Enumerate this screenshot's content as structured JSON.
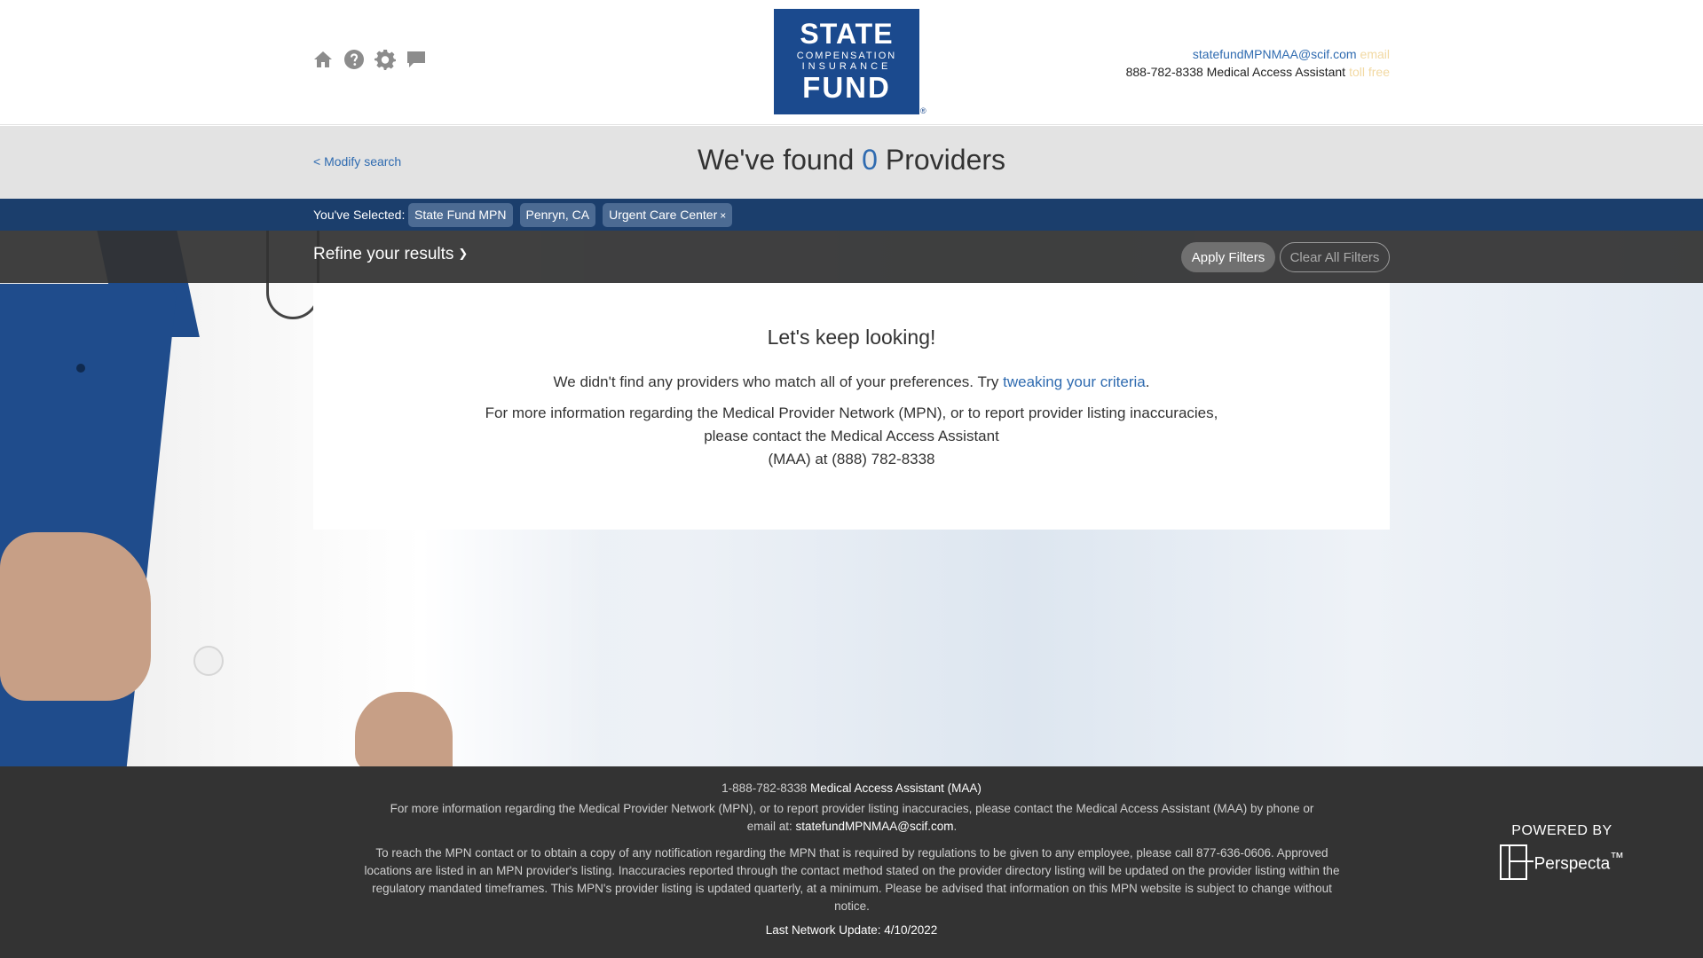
{
  "header": {
    "icons": [
      "home-icon",
      "help-icon",
      "settings-icon",
      "chat-icon"
    ],
    "logo": {
      "line1": "STATE",
      "line2": "COMPENSATION",
      "line3": "INSURANCE",
      "line4": "FUND",
      "reg": "®"
    },
    "contact": {
      "email": "statefundMPNMAA@scif.com",
      "email_tag": "email",
      "phone": "888-782-8338",
      "phone_label": "Medical Access Assistant",
      "phone_tag": "toll free"
    }
  },
  "search": {
    "modify_label": "< Modify search",
    "found_prefix": "We've found",
    "count": "0",
    "found_suffix": "Providers"
  },
  "selected": {
    "label": "You've Selected:",
    "chips": [
      "State Fund MPN",
      "Penryn, CA",
      "Urgent Care Center"
    ],
    "remove_glyph": "×"
  },
  "refine": {
    "title": "Refine your results",
    "apply_label": "Apply Filters",
    "clear_label": "Clear All Filters"
  },
  "results": {
    "heading": "Let's keep looking!",
    "line1_prefix": "We didn't find any providers who match all of your preferences. Try",
    "line1_link": "tweaking your criteria",
    "line1_suffix": ".",
    "line2": "For more information regarding the Medical Provider Network (MPN), or to report provider listing inaccuracies,",
    "line3": "please contact the Medical Access Assistant",
    "line4": "(MAA) at (888) 782-8338"
  },
  "footer": {
    "phone": "1-888-782-8338",
    "phone_label": "Medical Access Assistant (MAA)",
    "info": "For more information regarding the Medical Provider Network (MPN), or to report provider listing inaccuracies, please contact the Medical Access Assistant (MAA) by phone or email at:",
    "email": "statefundMPNMAA@scif.com",
    "email_suffix": ".",
    "notice": "To reach the MPN contact or to obtain a copy of any notification regarding the MPN that is required by regulations to be given to any employee, please call 877-636-0606. Approved locations are listed in an MPN provider's listing. Inaccuracies reported through the contact method stated on the provider directory listing will be updated on the provider listing within the regulatory mandated timeframes. This MPN's provider listing is updated quarterly, at a minimum. Please be advised that information on this MPN website is subject to change without notice.",
    "last_update": "Last Network Update: 4/10/2022",
    "powered_by": "POWERED BY",
    "powered_name": "Perspecta",
    "powered_tm": "™"
  },
  "colors": {
    "brand_blue": "#1b4a8e",
    "selected_bar": "#1b3e6c",
    "link": "#2f6bb0",
    "refine_bar": "#323232",
    "footer": "#333333"
  }
}
